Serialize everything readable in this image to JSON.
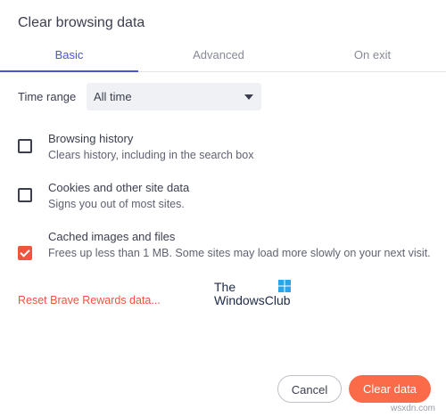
{
  "dialog": {
    "title": "Clear browsing data"
  },
  "tabs": [
    {
      "label": "Basic",
      "active": true
    },
    {
      "label": "Advanced",
      "active": false
    },
    {
      "label": "On exit",
      "active": false
    }
  ],
  "time_range": {
    "label": "Time range",
    "value": "All time"
  },
  "options": [
    {
      "title": "Browsing history",
      "description": "Clears history, including in the search box",
      "checked": false
    },
    {
      "title": "Cookies and other site data",
      "description": "Signs you out of most sites.",
      "checked": false
    },
    {
      "title": "Cached images and files",
      "description": "Frees up less than 1 MB. Some sites may load more slowly on your next visit.",
      "checked": true
    }
  ],
  "reset_link": "Reset Brave Rewards data...",
  "watermark": {
    "line1": "The",
    "line2": "WindowsClub"
  },
  "buttons": {
    "cancel": "Cancel",
    "clear": "Clear data"
  },
  "site_tag": "wsxdn.com",
  "colors": {
    "accent": "#4c54d2",
    "brand_orange": "#f0533e",
    "clear_button": "#fb6b4a"
  }
}
